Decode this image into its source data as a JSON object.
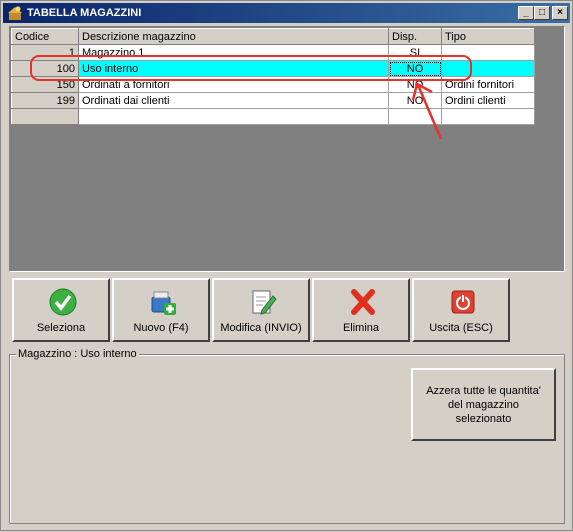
{
  "window": {
    "title": "TABELLA MAGAZZINI",
    "controls": [
      "_",
      "□",
      "×"
    ]
  },
  "grid": {
    "columns": [
      "Codice",
      "Descrizione magazzino",
      "Disp.",
      "Tipo"
    ],
    "rows": [
      {
        "code": "1",
        "description": "Magazzino 1",
        "disp": "SI",
        "type": "",
        "selected": false
      },
      {
        "code": "100",
        "description": "Uso interno",
        "disp": "NO",
        "type": "",
        "selected": true
      },
      {
        "code": "150",
        "description": "Ordinati a fornitori",
        "disp": "NO",
        "type": "Ordini fornitori",
        "selected": false
      },
      {
        "code": "199",
        "description": "Ordinati dai clienti",
        "disp": "NO",
        "type": "Ordini clienti",
        "selected": false
      },
      {
        "code": "",
        "description": "",
        "disp": "",
        "type": "",
        "selected": false
      }
    ]
  },
  "toolbar": {
    "select_label": "Seleziona",
    "new_label": "Nuovo (F4)",
    "edit_label": "Modifica (INVIO)",
    "delete_label": "Elimina",
    "exit_label": "Uscita (ESC)"
  },
  "details": {
    "legend": "Magazzino : Uso interno",
    "reset_label": "Azzera tutte le quantita' del magazzino selezionato"
  },
  "colors": {
    "title_bar": "#0a246a",
    "selected_row": "#00ffff",
    "annotation": "#e8312a",
    "face": "#d4d0c8"
  }
}
